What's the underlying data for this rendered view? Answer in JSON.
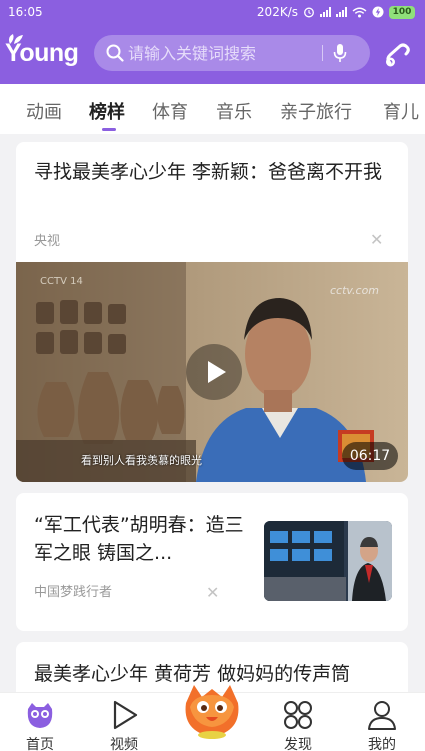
{
  "status_bar": {
    "time": "16:05",
    "net_speed": "202K/s",
    "battery": "100"
  },
  "header": {
    "logo_text": "Young",
    "search_placeholder": "请输入关键词搜索"
  },
  "tabs": [
    {
      "label": "动画",
      "active": false
    },
    {
      "label": "榜样",
      "active": true
    },
    {
      "label": "体育",
      "active": false
    },
    {
      "label": "音乐",
      "active": false
    },
    {
      "label": "亲子旅行",
      "active": false
    },
    {
      "label": "育儿",
      "active": false
    }
  ],
  "feed": {
    "card1": {
      "title": "寻找最美孝心少年  李新颖：爸爸离不开我",
      "source": "央视",
      "video": {
        "duration": "06:17",
        "subtitle": "看到别人看我羡慕的眼光",
        "watermark_left": "CCTV 14",
        "watermark_right": "cctv.com"
      }
    },
    "card2": {
      "title": "“军工代表”胡明春：造三军之眼 铸国之...",
      "source": "中国梦践行者"
    },
    "card3": {
      "title": "最美孝心少年 黄荷芳 做妈妈的传声筒"
    }
  },
  "bottom_nav": [
    {
      "label": "首页",
      "icon": "home-owl-icon"
    },
    {
      "label": "视频",
      "icon": "play-icon"
    },
    {
      "label": "",
      "icon": "mascot-icon"
    },
    {
      "label": "发现",
      "icon": "discover-icon"
    },
    {
      "label": "我的",
      "icon": "profile-icon"
    }
  ],
  "colors": {
    "brand_purple": "#8b5fe0",
    "search_bg": "#a98ae8",
    "card_bg": "#ffffff",
    "page_bg": "#f2f2f4"
  }
}
